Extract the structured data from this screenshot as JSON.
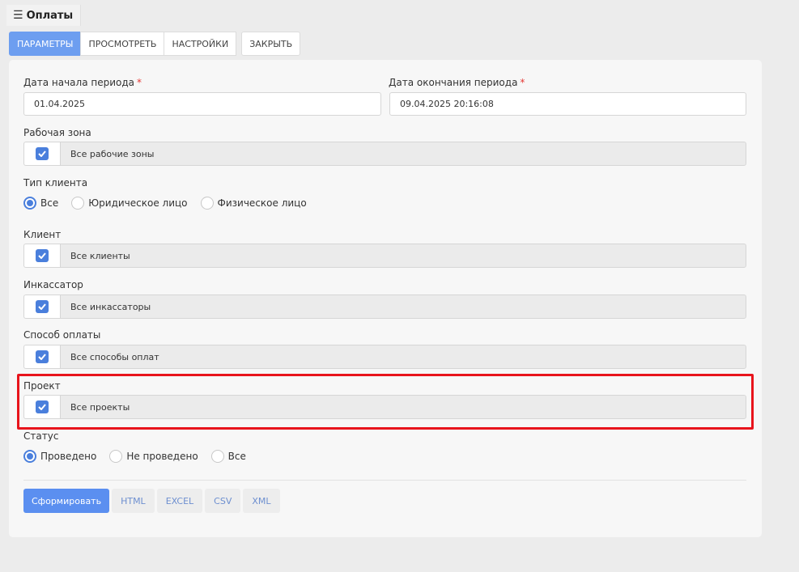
{
  "header": {
    "title": "Оплаты",
    "menu_icon": "hamburger-icon"
  },
  "tabs": [
    {
      "label": "ПАРАМЕТРЫ"
    },
    {
      "label": "ПРОСМОТРЕТЬ"
    },
    {
      "label": "НАСТРОЙКИ"
    },
    {
      "label": "ЗАКРЫТЬ"
    }
  ],
  "form": {
    "start_date": {
      "label": "Дата начала периода",
      "required_mark": "*",
      "value": "01.04.2025"
    },
    "end_date": {
      "label": "Дата окончания периода",
      "required_mark": "*",
      "value": "09.04.2025 20:16:08"
    },
    "work_zone": {
      "label": "Рабочая зона",
      "value": "Все рабочие зоны"
    },
    "client_type": {
      "label": "Тип клиента",
      "options": [
        "Все",
        "Юридическое лицо",
        "Физическое лицо"
      ],
      "selected": "Все"
    },
    "client": {
      "label": "Клиент",
      "value": "Все клиенты"
    },
    "collector": {
      "label": "Инкассатор",
      "value": "Все инкассаторы"
    },
    "payment_method": {
      "label": "Способ оплаты",
      "value": "Все способы оплат"
    },
    "project": {
      "label": "Проект",
      "value": "Все проекты"
    },
    "status": {
      "label": "Статус",
      "options": [
        "Проведено",
        "Не проведено",
        "Все"
      ],
      "selected": "Проведено"
    }
  },
  "actions": {
    "generate": "Сформировать",
    "exports": [
      "HTML",
      "EXCEL",
      "CSV",
      "XML"
    ]
  },
  "colors": {
    "accent": "#5b8ff0",
    "tab_active": "#6d9ef0",
    "highlight": "#e8141c",
    "required": "#e53935"
  }
}
